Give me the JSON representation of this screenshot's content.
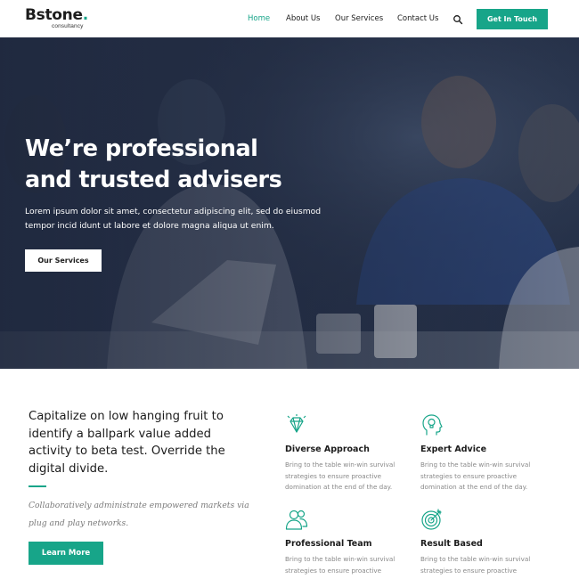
{
  "brand": {
    "name": "Bstone",
    "dot": ".",
    "tagline": "consultancy"
  },
  "nav": {
    "items": [
      {
        "label": "Home",
        "active": true
      },
      {
        "label": "About Us",
        "active": false
      },
      {
        "label": "Our Services",
        "active": false
      },
      {
        "label": "Contact Us",
        "active": false
      }
    ],
    "search_icon": "search-icon",
    "cta_label": "Get In Touch"
  },
  "hero": {
    "title_line1": "We’re professional",
    "title_line2": "and trusted advisers",
    "text": "Lorem ipsum dolor sit amet, consectetur adipiscing elit, sed do eiusmod tempor incid idunt ut labore et dolore magna aliqua ut enim.",
    "button_label": "Our Services"
  },
  "intro": {
    "title": "Capitalize on low hanging fruit to identify a ballpark value added activity to beta test. Override the digital divide.",
    "text": "Collaboratively administrate empowered markets via plug and play networks.",
    "button_label": "Learn More"
  },
  "features": [
    {
      "icon": "diamond-icon",
      "title": "Diverse Approach",
      "text": "Bring to the table win-win survival strategies to ensure proactive domination at the end of the day."
    },
    {
      "icon": "head-lightbulb-icon",
      "title": "Expert Advice",
      "text": "Bring to the table win-win survival strategies to ensure proactive domination at the end of the day."
    },
    {
      "icon": "team-icon",
      "title": "Professional Team",
      "text": "Bring to the table win-win survival strategies to ensure proactive"
    },
    {
      "icon": "target-icon",
      "title": "Result Based",
      "text": "Bring to the table win-win survival strategies to ensure proactive"
    }
  ],
  "colors": {
    "accent": "#17a589",
    "text": "#1c1c1c",
    "muted": "#888888",
    "hero_overlay": "#26324a"
  }
}
